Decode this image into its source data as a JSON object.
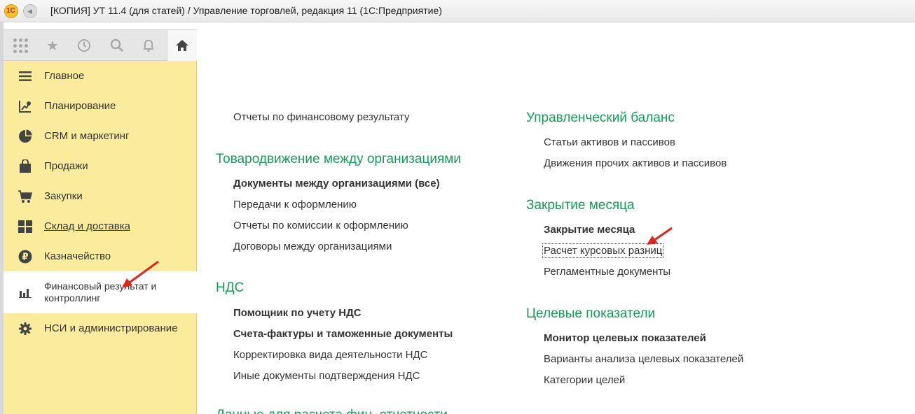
{
  "window": {
    "title": "[КОПИЯ] УТ 11.4 (для статей) / Управление торговлей, редакция 11  (1С:Предприятие)",
    "logo_text": "1С"
  },
  "toolbar": {
    "icons": [
      "apps-grid-icon",
      "star-icon",
      "history-icon",
      "search-icon",
      "bell-icon",
      "home-icon"
    ]
  },
  "sidebar": {
    "items": [
      {
        "label": "Главное",
        "icon": "menu-lines-icon"
      },
      {
        "label": "Планирование",
        "icon": "planning-icon"
      },
      {
        "label": "CRM и маркетинг",
        "icon": "pie-chart-icon"
      },
      {
        "label": "Продажи",
        "icon": "bag-icon"
      },
      {
        "label": "Закупки",
        "icon": "cart-icon"
      },
      {
        "label": "Склад и доставка",
        "icon": "warehouse-icon"
      },
      {
        "label": "Казначейство",
        "icon": "ruble-icon"
      },
      {
        "label": "Финансовый результат и контроллинг",
        "line1": "Финансовый результат и",
        "line2": "контроллинг",
        "icon": "bar-chart-icon"
      },
      {
        "label": "НСИ и администрирование",
        "icon": "gear-icon"
      }
    ]
  },
  "content": {
    "left": {
      "top_link": "Отчеты по финансовому результату",
      "sec1": {
        "title": "Товародвижение между организациями",
        "links": [
          "Документы между организациями (все)",
          "Передачи к оформлению",
          "Отчеты по комиссии к оформлению",
          "Договоры между организациями"
        ]
      },
      "sec2": {
        "title": "НДС",
        "links": [
          "Помощник по учету НДС",
          "Счета-фактуры и таможенные документы",
          "Корректировка вида деятельности НДС",
          "Иные документы подтверждения НДС"
        ]
      },
      "sec3_partial_title": "Данные для расчета фин. отчетности"
    },
    "right": {
      "sec1": {
        "title": "Управленческий баланс",
        "links": [
          "Статьи активов и пассивов",
          "Движения прочих активов и пассивов"
        ]
      },
      "sec2": {
        "title": "Закрытие месяца",
        "links": [
          "Закрытие месяца",
          "Расчет курсовых разниц",
          "Регламентные документы"
        ]
      },
      "sec3": {
        "title": "Целевые показатели",
        "links": [
          "Монитор целевых показателей",
          "Варианты анализа целевых показателей",
          "Категории целей"
        ]
      }
    }
  },
  "colors": {
    "sidebar_bg": "#fbec9d",
    "section_title": "#1a9a5a",
    "arrow": "#e0241b"
  }
}
